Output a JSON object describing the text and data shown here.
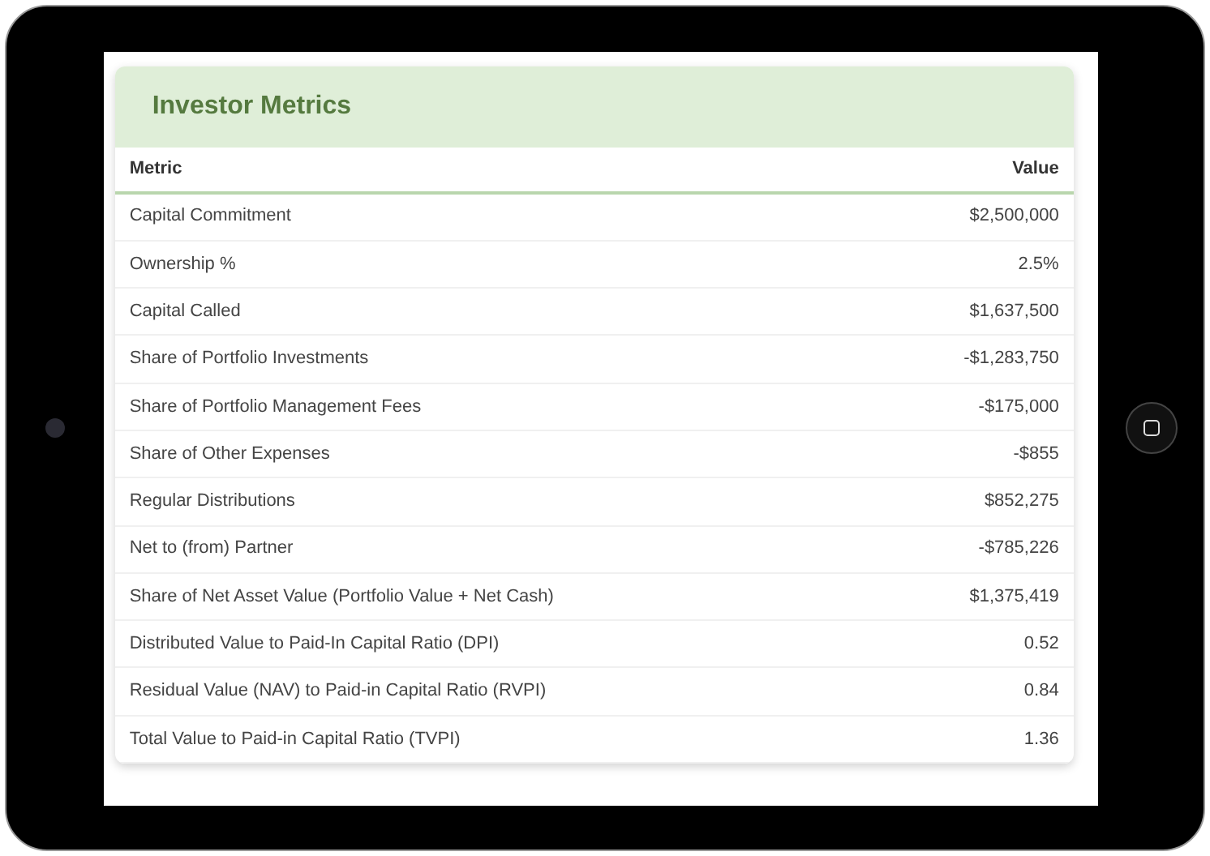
{
  "card": {
    "title": "Investor Metrics"
  },
  "table": {
    "columns": [
      "Metric",
      "Value"
    ],
    "rows": [
      {
        "metric": "Capital Commitment",
        "value": "$2,500,000"
      },
      {
        "metric": "Ownership %",
        "value": "2.5%"
      },
      {
        "metric": "Capital Called",
        "value": "$1,637,500"
      },
      {
        "metric": "Share of Portfolio Investments",
        "value": "-$1,283,750"
      },
      {
        "metric": "Share of Portfolio Management Fees",
        "value": "-$175,000"
      },
      {
        "metric": "Share of Other Expenses",
        "value": "-$855"
      },
      {
        "metric": "Regular Distributions",
        "value": "$852,275"
      },
      {
        "metric": "Net to (from) Partner",
        "value": "-$785,226"
      },
      {
        "metric": "Share of Net Asset Value (Portfolio Value + Net Cash)",
        "value": "$1,375,419"
      },
      {
        "metric": "Distributed Value to Paid-In Capital Ratio (DPI)",
        "value": "0.52"
      },
      {
        "metric": "Residual Value (NAV) to Paid-in Capital Ratio (RVPI)",
        "value": "0.84"
      },
      {
        "metric": "Total Value to Paid-in Capital Ratio (TVPI)",
        "value": "1.36"
      }
    ]
  }
}
